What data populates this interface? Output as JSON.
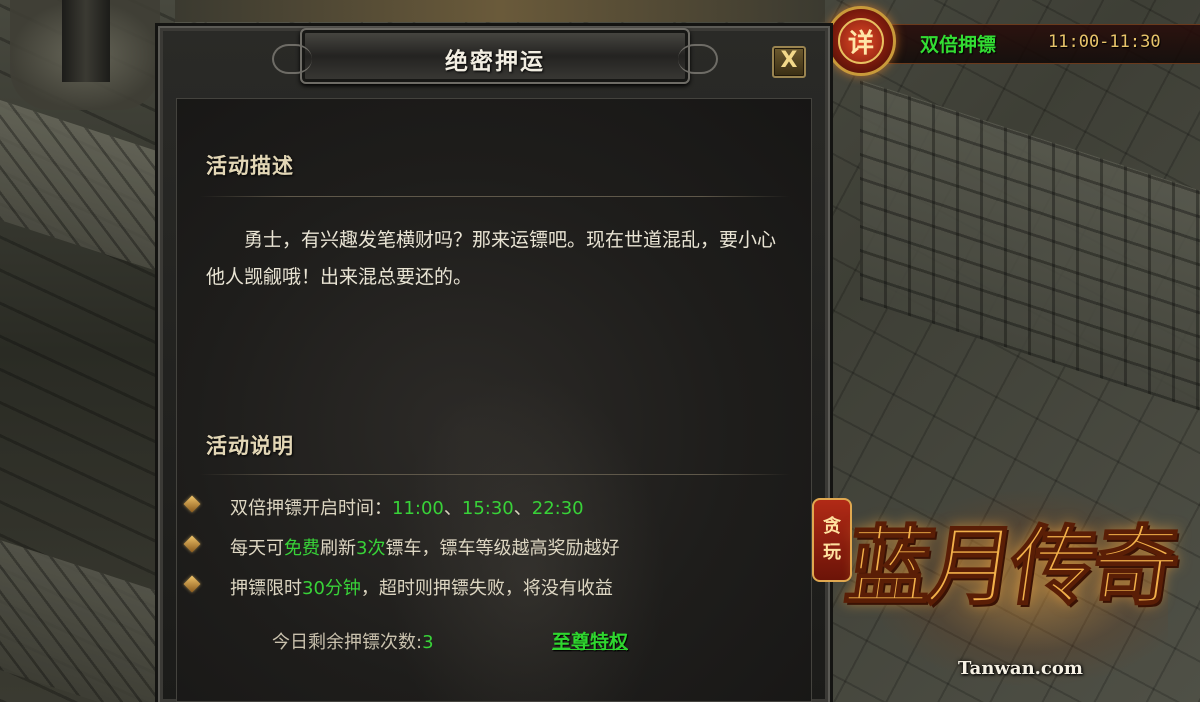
{
  "event_banner": {
    "badge_text": "详",
    "name": "双倍押镖",
    "time": "11:00-11:30"
  },
  "dialog": {
    "title": "绝密押运",
    "close_label": "X",
    "description": {
      "heading": "活动描述",
      "text": "勇士，有兴趣发笔横财吗？那来运镖吧。现在世道混乱，要小心他人觊觎哦！出来混总要还的。"
    },
    "rules": {
      "heading": "活动说明",
      "items": [
        {
          "parts": [
            "双倍押镖开启时间：",
            "11:00",
            "、",
            "15:30",
            "、",
            "22:30",
            ""
          ]
        },
        {
          "parts": [
            "每天可",
            "免费",
            "刷新",
            "3次",
            "镖车，镖车等级越高奖励越好"
          ]
        },
        {
          "parts": [
            "押镖限时",
            "30分钟",
            "，超时则押镖失败，将没有收益"
          ]
        }
      ],
      "remaining_label": "今日剩余押镖次数:",
      "remaining_count": "3",
      "vip_link": "至尊特权"
    }
  },
  "logo": {
    "seal_top": "贪",
    "seal_bottom": "玩",
    "title": "蓝月传奇",
    "site": "Tanwan.com"
  },
  "colors": {
    "highlight_green": "#38d238",
    "banner_gold": "#e8c46a",
    "text_light": "#e9e4d4"
  }
}
